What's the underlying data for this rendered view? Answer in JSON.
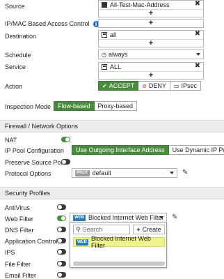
{
  "policy": {
    "source": {
      "label": "Source",
      "entries": [
        "All-Test-Mac-Address"
      ]
    },
    "ipmac": {
      "label": "IP/MAC Based Access Control"
    },
    "destination": {
      "label": "Destination",
      "entries": [
        "all"
      ]
    },
    "schedule": {
      "label": "Schedule",
      "value": "always"
    },
    "service": {
      "label": "Service",
      "entries": [
        "ALL"
      ]
    },
    "action": {
      "label": "Action",
      "options": [
        "ACCEPT",
        "DENY",
        "IPsec"
      ],
      "selected": "ACCEPT"
    },
    "inspection_mode": {
      "label": "Inspection Mode",
      "options": [
        "Flow-based",
        "Proxy-based"
      ],
      "selected": "Flow-based"
    }
  },
  "firewall_section": {
    "title": "Firewall / Network Options",
    "nat": {
      "label": "NAT",
      "enabled": true
    },
    "ip_pool": {
      "label": "IP Pool Configuration",
      "options": [
        "Use Outgoing Interface Address",
        "Use Dynamic IP Pool"
      ],
      "selected": "Use Outgoing Interface Address"
    },
    "preserve_port": {
      "label": "Preserve Source Port",
      "enabled": false
    },
    "protocol_options": {
      "label": "Protocol Options",
      "badge": "PROT",
      "value": "default"
    }
  },
  "security_section": {
    "title": "Security Profiles",
    "items": [
      {
        "label": "AntiVirus",
        "enabled": false
      },
      {
        "label": "Web Filter",
        "enabled": true
      },
      {
        "label": "DNS Filter",
        "enabled": false
      },
      {
        "label": "Application Control",
        "enabled": false
      },
      {
        "label": "IPS",
        "enabled": false
      },
      {
        "label": "File Filter",
        "enabled": false
      },
      {
        "label": "Email Filter",
        "enabled": false
      }
    ],
    "web_filter_select": {
      "badge": "WEB",
      "value": "Blocked Internet Web Filter"
    }
  },
  "popup": {
    "search_placeholder": "Search",
    "create_label": "Create",
    "item_badge": "WEB",
    "item_label": "Blocked Internet Web Filter"
  },
  "colors": {
    "accent_green": "#4a8c3f",
    "highlight_yellow": "#eff48e",
    "web_badge": "#2f7ab5"
  }
}
